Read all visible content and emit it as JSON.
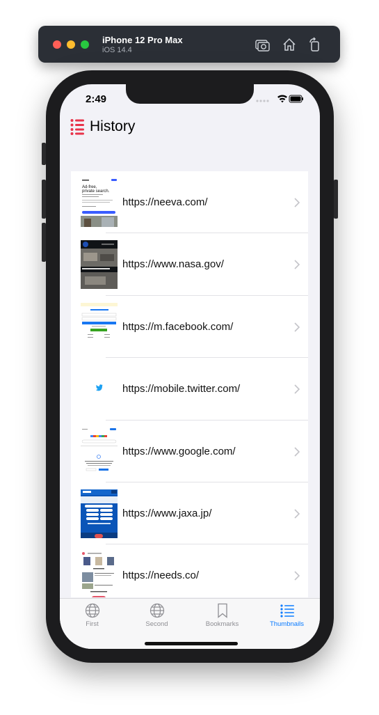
{
  "simulator": {
    "device": "iPhone 12 Pro Max",
    "os": "iOS 14.4",
    "icons": [
      "screenshot-icon",
      "home-icon",
      "rotate-icon"
    ]
  },
  "status_bar": {
    "time": "2:49"
  },
  "nav": {
    "title": "History",
    "icon": "list-icon",
    "accent": "#e8334a"
  },
  "history": [
    {
      "url": "https://neeva.com/"
    },
    {
      "url": "https://www.nasa.gov/"
    },
    {
      "url": "https://m.facebook.com/"
    },
    {
      "url": "https://mobile.twitter.com/"
    },
    {
      "url": "https://www.google.com/"
    },
    {
      "url": "https://www.jaxa.jp/"
    },
    {
      "url": "https://needs.co/"
    }
  ],
  "thumbnails": {
    "neeva": {
      "headline": "Ad-free, private search."
    }
  },
  "tabbar": {
    "tabs": [
      {
        "label": "First",
        "icon": "globe-icon",
        "active": false
      },
      {
        "label": "Second",
        "icon": "globe-icon",
        "active": false
      },
      {
        "label": "Bookmarks",
        "icon": "bookmark-icon",
        "active": false
      },
      {
        "label": "Thumbnails",
        "icon": "list-icon",
        "active": true
      }
    ],
    "active_color": "#0a7bff",
    "inactive_color": "#8e8e93"
  }
}
